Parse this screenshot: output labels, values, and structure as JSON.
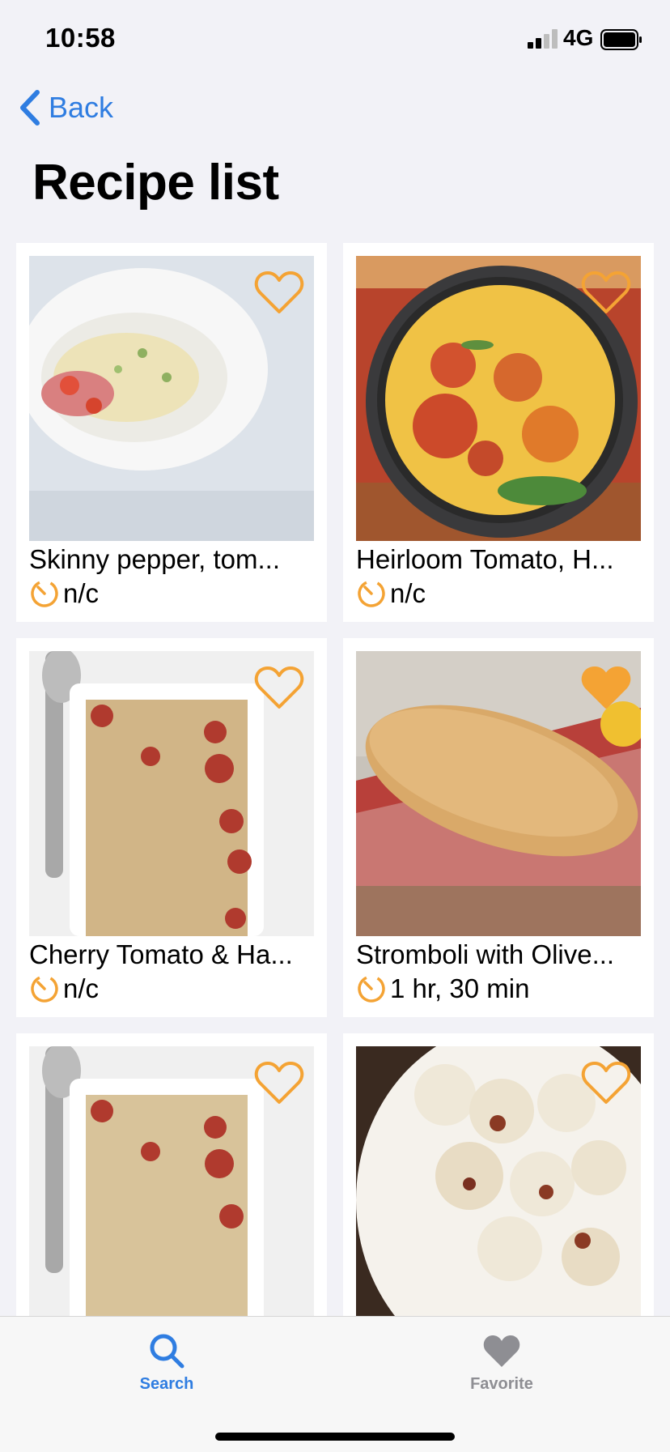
{
  "status_bar": {
    "time": "10:58",
    "network": "4G"
  },
  "nav": {
    "back_label": "Back",
    "title": "Recipe list"
  },
  "colors": {
    "accent": "#2f7de1",
    "favorite": "#f4a334",
    "inactive": "#8e8e93"
  },
  "recipes": [
    {
      "title": "Skinny pepper, tom...",
      "time": "n/c",
      "favorited": false,
      "icon": "timer-icon"
    },
    {
      "title": "Heirloom Tomato, H...",
      "time": "n/c",
      "favorited": false,
      "icon": "timer-icon"
    },
    {
      "title": "Cherry Tomato & Ha...",
      "time": "n/c",
      "favorited": false,
      "icon": "timer-icon"
    },
    {
      "title": "Stromboli with Olive...",
      "time": "1 hr, 30 min",
      "favorited": true,
      "icon": "timer-icon"
    },
    {
      "title": "",
      "time": "",
      "favorited": false,
      "icon": "timer-icon"
    },
    {
      "title": "",
      "time": "",
      "favorited": false,
      "icon": "timer-icon"
    }
  ],
  "tab_bar": {
    "tabs": [
      {
        "label": "Search",
        "icon": "search-icon",
        "active": true
      },
      {
        "label": "Favorite",
        "icon": "heart-icon",
        "active": false
      }
    ]
  }
}
